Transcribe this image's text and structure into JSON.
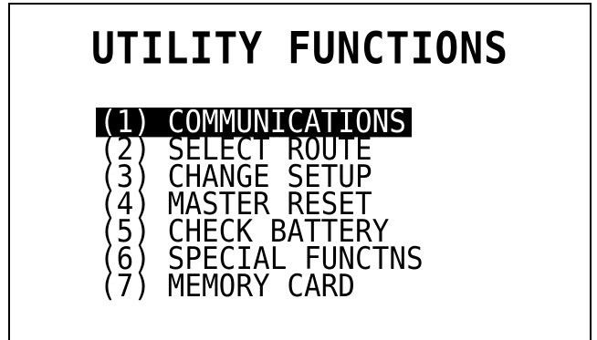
{
  "screen": {
    "title": "UTILITY FUNCTIONS"
  },
  "menu": {
    "selected_index": 0,
    "items": [
      {
        "number": "(1)",
        "label": "COMMUNICATIONS"
      },
      {
        "number": "(2)",
        "label": "SELECT ROUTE"
      },
      {
        "number": "(3)",
        "label": "CHANGE SETUP"
      },
      {
        "number": "(4)",
        "label": "MASTER RESET"
      },
      {
        "number": "(5)",
        "label": "CHECK BATTERY"
      },
      {
        "number": "(6)",
        "label": "SPECIAL FUNCTNS"
      },
      {
        "number": "(7)",
        "label": "MEMORY CARD"
      }
    ]
  },
  "colors": {
    "background": "#ffffff",
    "foreground": "#000000",
    "highlight_bg": "#000000",
    "highlight_fg": "#ffffff"
  }
}
